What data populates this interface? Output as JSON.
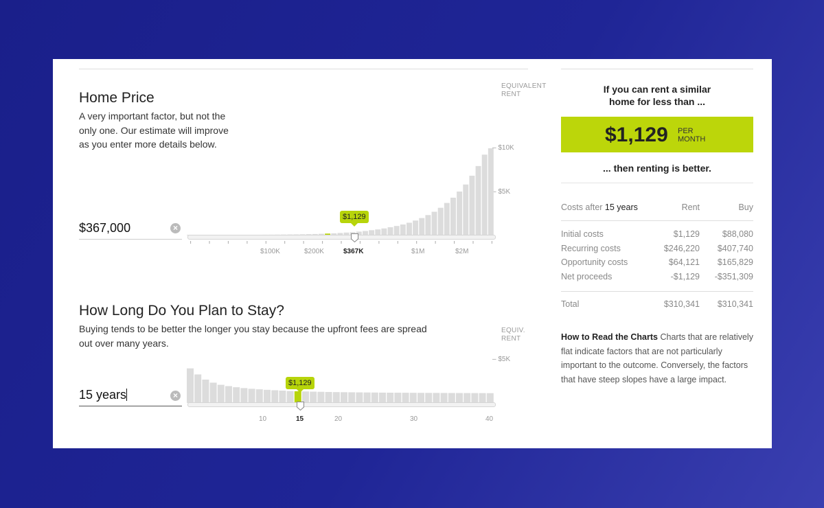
{
  "home_price": {
    "title": "Home Price",
    "description": [
      "A very important factor, but not the",
      "only one. Our estimate will improve",
      "as you enter more details below."
    ],
    "value": "$367,000",
    "clear_icon": "×",
    "axis_title": [
      "EQUIVALENT",
      "RENT"
    ],
    "y_ticks": [
      "$10K",
      "$5K"
    ],
    "x_ticks": [
      "$100K",
      "$200K",
      "$367K",
      "$1M",
      "$2M"
    ],
    "badge": "$1,129"
  },
  "stay": {
    "title": "How Long Do You Plan to Stay?",
    "description": [
      "Buying tends to be better the longer you stay because the upfront fees are spread",
      "out over many years."
    ],
    "value": "15 years",
    "clear_icon": "×",
    "axis_title": [
      "EQUIV.",
      "RENT"
    ],
    "y_ticks": [
      "$5K"
    ],
    "x_ticks": [
      "10",
      "15",
      "20",
      "30",
      "40"
    ],
    "badge": "$1,129"
  },
  "summary": {
    "intro": [
      "If you can rent a similar",
      "home for less than ..."
    ],
    "amount": "$1,129",
    "per": [
      "PER",
      "MONTH"
    ],
    "outro": "... then renting is better.",
    "table_header": {
      "label": "Costs after",
      "years": "15 years",
      "rent": "Rent",
      "buy": "Buy"
    },
    "rows": [
      {
        "label": "Initial costs",
        "rent": "$1,129",
        "buy": "$88,080"
      },
      {
        "label": "Recurring costs",
        "rent": "$246,220",
        "buy": "$407,740"
      },
      {
        "label": "Opportunity costs",
        "rent": "$64,121",
        "buy": "$165,829"
      },
      {
        "label": "Net proceeds",
        "rent": "-$1,129",
        "buy": "-$351,309"
      }
    ],
    "total": {
      "label": "Total",
      "rent": "$310,341",
      "buy": "$310,341"
    },
    "help_title": "How to Read the Charts",
    "help_text": "Charts that are relatively flat indicate factors that are not particularly important to the outcome. Conversely, the factors that have steep slopes have a large impact."
  },
  "colors": {
    "accent": "#b7d40a",
    "bar": "#dcdcdc",
    "background": "#1f2596"
  },
  "chart_data": [
    {
      "type": "bar",
      "name": "home-price",
      "xlabel": "",
      "ylabel": "EQUIVALENT RENT",
      "y_tick_values": [
        10000,
        5000
      ],
      "selected_index": 22,
      "values": [
        60,
        61,
        62,
        63,
        64,
        66,
        68,
        70,
        72,
        75,
        78,
        82,
        86,
        90,
        96,
        102,
        110,
        120,
        132,
        148,
        166,
        188,
        214,
        246,
        284,
        330,
        380,
        440,
        512,
        600,
        690,
        800,
        940,
        1080,
        1250,
        1450,
        1700,
        1980,
        2320,
        2700,
        3150,
        3700,
        4300,
        5000,
        5800,
        6800,
        7900,
        9200,
        10150
      ]
    },
    {
      "type": "bar",
      "name": "length-of-stay",
      "xlabel": "",
      "ylabel": "EQUIV. RENT",
      "y_tick_values": [
        5000
      ],
      "selected_index": 14,
      "values": [
        4000,
        3300,
        2700,
        2350,
        2100,
        1950,
        1820,
        1720,
        1640,
        1580,
        1520,
        1470,
        1430,
        1390,
        1360,
        1330,
        1310,
        1290,
        1270,
        1255,
        1245,
        1235,
        1225,
        1215,
        1205,
        1195,
        1190,
        1185,
        1180,
        1175,
        1170,
        1166,
        1162,
        1158,
        1154,
        1150,
        1146,
        1142,
        1139,
        1136
      ]
    }
  ]
}
